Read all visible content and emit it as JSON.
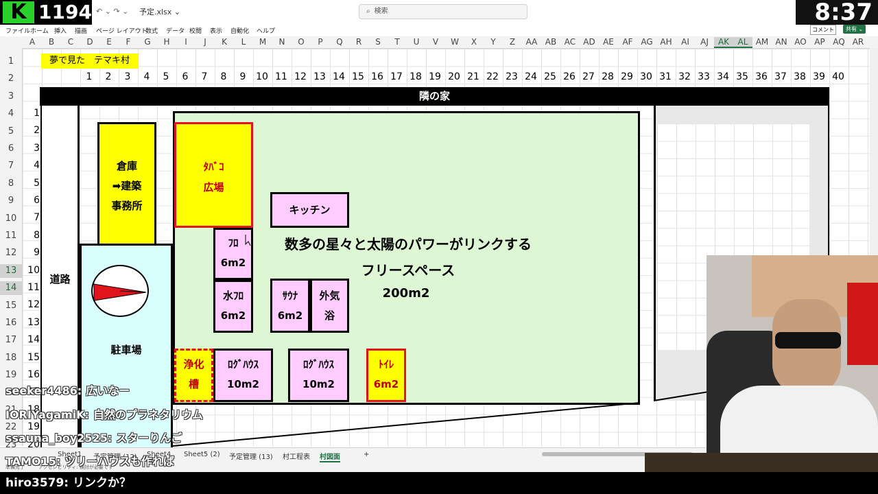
{
  "stream": {
    "counter": "1194",
    "logo_letter": "K",
    "clock": "8:37"
  },
  "titlebar": {
    "undo_redo": "↶ ⌄  ↷ ⌄",
    "filename": "予定.xlsx ⌄",
    "search_placeholder": "検索"
  },
  "ribbon": {
    "menu": [
      "ファイル",
      "ホーム",
      "挿入",
      "描画",
      "ページ レイアウト",
      "数式",
      "データ",
      "校閲",
      "表示",
      "自動化",
      "ヘルプ"
    ],
    "comment_button": "コメント",
    "share_button": "共有 ⌄"
  },
  "columns": [
    "A",
    "B",
    "C",
    "D",
    "E",
    "F",
    "G",
    "H",
    "I",
    "J",
    "K",
    "L",
    "M",
    "N",
    "O",
    "P",
    "Q",
    "R",
    "S",
    "T",
    "U",
    "V",
    "W",
    "X",
    "Y",
    "Z",
    "AA",
    "AB",
    "AC",
    "AD",
    "AE",
    "AF",
    "AG",
    "AH",
    "AI",
    "AJ",
    "AK",
    "AL",
    "AM",
    "AN",
    "AO",
    "AP",
    "AQ",
    "AR"
  ],
  "selected_columns": [
    "AK",
    "AL"
  ],
  "rows": [
    "1",
    "2",
    "3",
    "4",
    "5",
    "6",
    "7",
    "8",
    "9",
    "10",
    "11",
    "12",
    "13",
    "14",
    "15",
    "16",
    "17",
    "18",
    "19",
    "20",
    "21",
    "22",
    "23"
  ],
  "selected_rows": [
    "13",
    "14"
  ],
  "sheet": {
    "title_cell": "夢で見た　テマキ村",
    "col_numbers": [
      "1",
      "2",
      "3",
      "4",
      "5",
      "6",
      "7",
      "8",
      "9",
      "10",
      "11",
      "12",
      "13",
      "14",
      "15",
      "16",
      "17",
      "18",
      "19",
      "20",
      "21",
      "22",
      "23",
      "24",
      "25",
      "26",
      "27",
      "28",
      "29",
      "30",
      "31",
      "32",
      "33",
      "34",
      "35",
      "36",
      "37",
      "38",
      "39",
      "40"
    ],
    "row_numbers": [
      "1",
      "2",
      "3",
      "4",
      "5",
      "6",
      "7",
      "8",
      "9",
      "10",
      "11",
      "12",
      "13",
      "14",
      "15",
      "16",
      "17",
      "18",
      "19",
      "20"
    ],
    "neighbor": "隣の家",
    "road": "道路",
    "parking": "駐車場",
    "warehouse": [
      "倉庫",
      "➡建築",
      "事務所"
    ],
    "tobacco": [
      "ﾀﾊﾞｺ",
      "広場"
    ],
    "kitchen": "キッチン",
    "bath": [
      "ﾌﾛ",
      "6m2"
    ],
    "water_bath": [
      "水ﾌﾛ",
      "6m2"
    ],
    "sauna": [
      "ｻｳﾅ",
      "6m2"
    ],
    "outdoor_bath": [
      "外気",
      "浴"
    ],
    "septic": [
      "浄化",
      "槽"
    ],
    "log_house_1": [
      "ﾛｸﾞﾊｳｽ",
      "10m2"
    ],
    "log_house_2": [
      "ﾛｸﾞﾊｳｽ",
      "10m2"
    ],
    "toilet": [
      "ﾄｲﾚ",
      "6m2"
    ],
    "free_space_title": [
      "数多の星々と太陽のパワーがリンクする",
      "フリースペース"
    ],
    "free_space_area": "200m2"
  },
  "sheet_tabs": [
    "Sheet1",
    "予定管理 (12)",
    "Sheet4",
    "Sheet5 (2)",
    "予定管理 (13)",
    "村工程表",
    "村図面"
  ],
  "active_tab": "村図面",
  "status": {
    "left": "準備完了",
    "accessibility": "アクセシビリティ: 検討が必要です"
  },
  "chat": [
    {
      "user": "seeker4486:",
      "text": "広いなー"
    },
    {
      "user": "IORIYagamiK:",
      "text": "自然のプラネタリウム"
    },
    {
      "user": "ssauna_boy2525:",
      "text": "スターりんご"
    },
    {
      "user": "TAMO15:",
      "text": "ツリーハウスも作れば"
    }
  ],
  "chat_bottom": {
    "user": "hiro3579:",
    "text": "リンクか？"
  },
  "colors": {
    "excel_green": "#217346",
    "yellow": "#ffff00",
    "pink": "#ffccff",
    "free_space": "#ddf7d4",
    "parking": "#d9ffff",
    "red": "#e0141b"
  }
}
